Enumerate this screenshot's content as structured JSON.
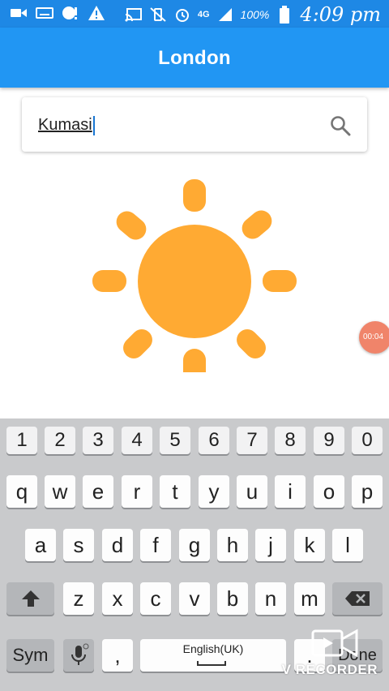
{
  "status_bar": {
    "network": "4G",
    "battery_percent": "100%",
    "time": "4:09 pm"
  },
  "app_bar": {
    "title": "London"
  },
  "search": {
    "value": "Kumasi",
    "icon": "search-icon"
  },
  "weather": {
    "icon": "sun-icon",
    "colors": {
      "sun": "#ffaa33"
    }
  },
  "recorder_bubble": {
    "time": "00:04"
  },
  "keyboard": {
    "number_row": [
      "1",
      "2",
      "3",
      "4",
      "5",
      "6",
      "7",
      "8",
      "9",
      "0"
    ],
    "row1": [
      "q",
      "w",
      "e",
      "r",
      "t",
      "y",
      "u",
      "i",
      "o",
      "p"
    ],
    "row2": [
      "a",
      "s",
      "d",
      "f",
      "g",
      "h",
      "j",
      "k",
      "l"
    ],
    "row3": [
      "z",
      "x",
      "c",
      "v",
      "b",
      "n",
      "m"
    ],
    "sym_label": "Sym",
    "comma": ",",
    "space_label": "English(UK)",
    "period": ".",
    "done_label": "Done"
  },
  "watermark": {
    "text": "V RECORDER"
  },
  "colors": {
    "app_bar": "#2196f3",
    "status_bar": "#1e88e5",
    "keyboard_bg": "#c9cacc"
  }
}
